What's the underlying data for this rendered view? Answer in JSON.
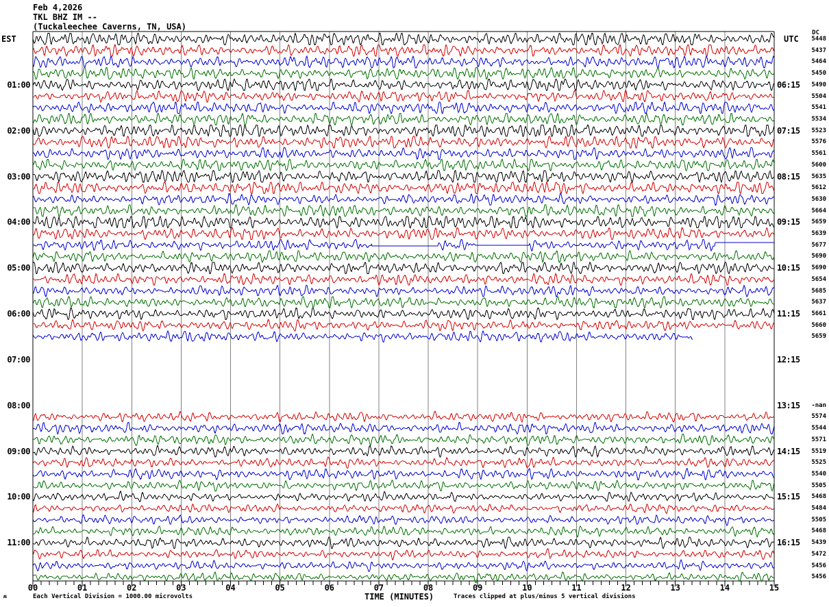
{
  "title": {
    "date": "Feb 4,2026",
    "station": "TKL BHZ IM --",
    "location": "(Tuckaleechee Caverns, TN, USA)"
  },
  "headers": {
    "left": "EST",
    "right": "UTC",
    "dc": "DC"
  },
  "left_hour_labels": [
    {
      "row": 4,
      "text": "01:00"
    },
    {
      "row": 8,
      "text": "02:00"
    },
    {
      "row": 12,
      "text": "03:00"
    },
    {
      "row": 16,
      "text": "04:00"
    },
    {
      "row": 20,
      "text": "05:00"
    },
    {
      "row": 24,
      "text": "06:00"
    },
    {
      "row": 28,
      "text": "07:00"
    },
    {
      "row": 32,
      "text": "08:00"
    },
    {
      "row": 36,
      "text": "09:00"
    },
    {
      "row": 40,
      "text": "10:00"
    },
    {
      "row": 44,
      "text": "11:00"
    }
  ],
  "right_hour_labels": [
    {
      "row": 4,
      "text": "06:15"
    },
    {
      "row": 8,
      "text": "07:15"
    },
    {
      "row": 12,
      "text": "08:15"
    },
    {
      "row": 16,
      "text": "09:15"
    },
    {
      "row": 20,
      "text": "10:15"
    },
    {
      "row": 24,
      "text": "11:15"
    },
    {
      "row": 28,
      "text": "12:15"
    },
    {
      "row": 32,
      "text": "13:15"
    },
    {
      "row": 36,
      "text": "14:15"
    },
    {
      "row": 40,
      "text": "15:15"
    },
    {
      "row": 44,
      "text": "16:15"
    }
  ],
  "x_axis": {
    "minute_labels": [
      "00",
      "01",
      "02",
      "03",
      "04",
      "05",
      "06",
      "07",
      "08",
      "09",
      "10",
      "11",
      "12",
      "13",
      "14",
      "15"
    ],
    "label": "TIME (MINUTES)"
  },
  "footer": {
    "left": "Each Vertical Division = 1000.00 microvolts",
    "right": "Traces clipped at plus/minus 5 vertical divisions",
    "watermark": "ʍ"
  },
  "chart_data": {
    "type": "line",
    "kind": "helicorder-seismogram",
    "station_id": "TKL BHZ IM --",
    "station_name": "(Tuckaleechee Caverns, TN, USA)",
    "date": "Feb 4,2026",
    "x_range_minutes": [
      0,
      15
    ],
    "minutes_per_row": 15,
    "rows_per_hour": 4,
    "local_timezone": "EST",
    "utc_offset_hours": 5,
    "grid": true,
    "grid_color": "#808080",
    "trace_colors_cycle": [
      "#000000",
      "#d40000",
      "#0000cc",
      "#007000"
    ],
    "vertical_division_microvolts": "1000.00",
    "clip_divisions": 5,
    "rows": [
      {
        "i": 0,
        "est": "00:00",
        "dc": "5448",
        "present": true,
        "amp": 7.5,
        "end": 15
      },
      {
        "i": 1,
        "est": "00:15",
        "dc": "5437",
        "present": true,
        "amp": 6.5,
        "end": 15
      },
      {
        "i": 2,
        "est": "00:30",
        "dc": "5464",
        "present": true,
        "amp": 6.5,
        "end": 15
      },
      {
        "i": 3,
        "est": "00:45",
        "dc": "5450",
        "present": true,
        "amp": 6.5,
        "end": 15
      },
      {
        "i": 4,
        "est": "01:00",
        "dc": "5490",
        "present": true,
        "amp": 7.0,
        "end": 15
      },
      {
        "i": 5,
        "est": "01:15",
        "dc": "5504",
        "present": true,
        "amp": 6.0,
        "end": 15
      },
      {
        "i": 6,
        "est": "01:30",
        "dc": "5541",
        "present": true,
        "amp": 6.5,
        "end": 15
      },
      {
        "i": 7,
        "est": "01:45",
        "dc": "5534",
        "present": true,
        "amp": 6.5,
        "end": 15
      },
      {
        "i": 8,
        "est": "02:00",
        "dc": "5523",
        "present": true,
        "amp": 8.0,
        "end": 15
      },
      {
        "i": 9,
        "est": "02:15",
        "dc": "5576",
        "present": true,
        "amp": 7.0,
        "end": 15
      },
      {
        "i": 10,
        "est": "02:30",
        "dc": "5561",
        "present": true,
        "amp": 6.0,
        "end": 15
      },
      {
        "i": 11,
        "est": "02:45",
        "dc": "5600",
        "present": true,
        "amp": 6.5,
        "end": 15
      },
      {
        "i": 12,
        "est": "03:00",
        "dc": "5635",
        "present": true,
        "amp": 7.5,
        "end": 15
      },
      {
        "i": 13,
        "est": "03:15",
        "dc": "5612",
        "present": true,
        "amp": 7.0,
        "end": 15
      },
      {
        "i": 14,
        "est": "03:30",
        "dc": "5630",
        "present": true,
        "amp": 5.5,
        "end": 15
      },
      {
        "i": 15,
        "est": "03:45",
        "dc": "5664",
        "present": true,
        "amp": 6.5,
        "end": 15
      },
      {
        "i": 16,
        "est": "04:00",
        "dc": "5659",
        "present": true,
        "amp": 8.0,
        "end": 15
      },
      {
        "i": 17,
        "est": "04:15",
        "dc": "5639",
        "present": true,
        "amp": 6.5,
        "end": 15
      },
      {
        "i": 18,
        "est": "04:30",
        "dc": "5677",
        "present": true,
        "amp": 5.5,
        "end": 15,
        "flats": [
          [
            6.85,
            8.2,
            1
          ],
          [
            8.95,
            10.05,
            0
          ],
          [
            13.8,
            15,
            -4
          ]
        ]
      },
      {
        "i": 19,
        "est": "04:45",
        "dc": "5690",
        "present": true,
        "amp": 6.0,
        "end": 15
      },
      {
        "i": 20,
        "est": "05:00",
        "dc": "5690",
        "present": true,
        "amp": 6.5,
        "end": 15
      },
      {
        "i": 21,
        "est": "05:15",
        "dc": "5654",
        "present": true,
        "amp": 6.0,
        "end": 15
      },
      {
        "i": 22,
        "est": "05:30",
        "dc": "5685",
        "present": true,
        "amp": 5.5,
        "end": 15
      },
      {
        "i": 23,
        "est": "05:45",
        "dc": "5637",
        "present": true,
        "amp": 6.0,
        "end": 15
      },
      {
        "i": 24,
        "est": "06:00",
        "dc": "5661",
        "present": true,
        "amp": 6.0,
        "end": 15
      },
      {
        "i": 25,
        "est": "06:15",
        "dc": "5660",
        "present": true,
        "amp": 5.5,
        "end": 15
      },
      {
        "i": 26,
        "est": "06:30",
        "dc": "5659",
        "present": true,
        "amp": 5.5,
        "end": 13.35
      },
      {
        "i": 27,
        "est": "06:45",
        "dc": null,
        "present": false,
        "amp": 0,
        "end": 0
      },
      {
        "i": 28,
        "est": "07:00",
        "dc": null,
        "present": false,
        "amp": 0,
        "end": 0
      },
      {
        "i": 29,
        "est": "07:15",
        "dc": null,
        "present": false,
        "amp": 0,
        "end": 0
      },
      {
        "i": 30,
        "est": "07:30",
        "dc": null,
        "present": false,
        "amp": 0,
        "end": 0
      },
      {
        "i": 31,
        "est": "07:45",
        "dc": null,
        "present": false,
        "amp": 0,
        "end": 0
      },
      {
        "i": 32,
        "est": "08:00",
        "dc": "-nan",
        "present": false,
        "amp": 0,
        "end": 0
      },
      {
        "i": 33,
        "est": "08:15",
        "dc": "5574",
        "present": true,
        "amp": 5.0,
        "end": 15
      },
      {
        "i": 34,
        "est": "08:30",
        "dc": "5544",
        "present": true,
        "amp": 5.5,
        "end": 15
      },
      {
        "i": 35,
        "est": "08:45",
        "dc": "5571",
        "present": true,
        "amp": 5.5,
        "end": 15
      },
      {
        "i": 36,
        "est": "09:00",
        "dc": "5519",
        "present": true,
        "amp": 5.5,
        "end": 15
      },
      {
        "i": 37,
        "est": "09:15",
        "dc": "5525",
        "present": true,
        "amp": 5.0,
        "end": 15
      },
      {
        "i": 38,
        "est": "09:30",
        "dc": "5540",
        "present": true,
        "amp": 5.5,
        "end": 15
      },
      {
        "i": 39,
        "est": "09:45",
        "dc": "5505",
        "present": true,
        "amp": 5.0,
        "end": 15
      },
      {
        "i": 40,
        "est": "10:00",
        "dc": "5468",
        "present": true,
        "amp": 4.5,
        "end": 15
      },
      {
        "i": 41,
        "est": "10:15",
        "dc": "5484",
        "present": true,
        "amp": 4.5,
        "end": 15
      },
      {
        "i": 42,
        "est": "10:30",
        "dc": "5505",
        "present": true,
        "amp": 4.5,
        "end": 15
      },
      {
        "i": 43,
        "est": "10:45",
        "dc": "5468",
        "present": true,
        "amp": 5.0,
        "end": 15
      },
      {
        "i": 44,
        "est": "11:00",
        "dc": "5439",
        "present": true,
        "amp": 5.5,
        "end": 15
      },
      {
        "i": 45,
        "est": "11:15",
        "dc": "5472",
        "present": true,
        "amp": 4.5,
        "end": 15
      },
      {
        "i": 46,
        "est": "11:30",
        "dc": "5456",
        "present": true,
        "amp": 4.5,
        "end": 15
      },
      {
        "i": 47,
        "est": "11:45",
        "dc": "5456",
        "present": true,
        "amp": 4.5,
        "end": 15
      }
    ]
  }
}
